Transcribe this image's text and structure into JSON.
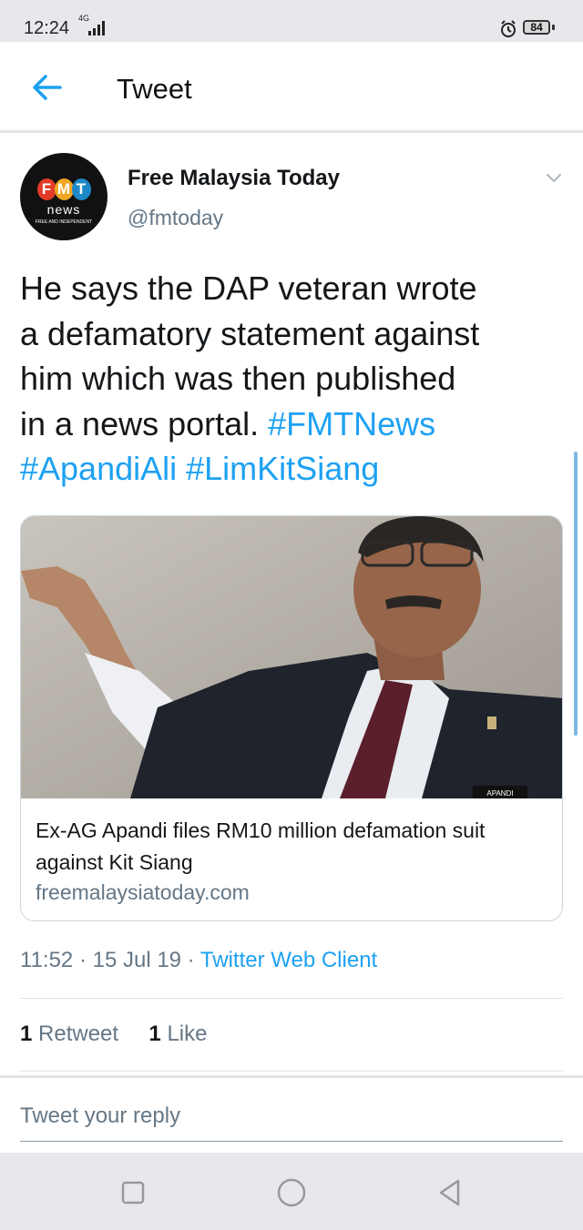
{
  "status_bar": {
    "time": "12:24",
    "network": "4G",
    "battery": "84"
  },
  "app_bar": {
    "title": "Tweet"
  },
  "tweet": {
    "author_name": "Free Malaysia Today",
    "author_handle": "@fmtoday",
    "avatar": {
      "letters": [
        "F",
        "M",
        "T"
      ],
      "label": "news",
      "tagline": "FREE AND INDEPENDENT"
    },
    "text_lines": [
      "He says the DAP veteran wrote",
      "a defamatory statement against",
      "him which was then published",
      "in a news portal. "
    ],
    "hashtags": [
      "#FMTNews",
      "#ApandiAli",
      "#LimKitSiang"
    ],
    "card": {
      "title": "Ex-AG Apandi files RM10 million defamation suit against Kit Siang",
      "domain": "freemalaysiatoday.com",
      "image_badge": "APANDI"
    },
    "time": "11:52",
    "date": "15 Jul 19",
    "separator": " · ",
    "client": "Twitter Web Client",
    "retweets": {
      "count": "1",
      "label": "Retweet"
    },
    "likes": {
      "count": "1",
      "label": "Like"
    }
  },
  "reply": {
    "placeholder": "Tweet your reply"
  },
  "colors": {
    "link": "#1da1f2",
    "secondary_text": "#657786",
    "primary_text": "#14171a"
  }
}
